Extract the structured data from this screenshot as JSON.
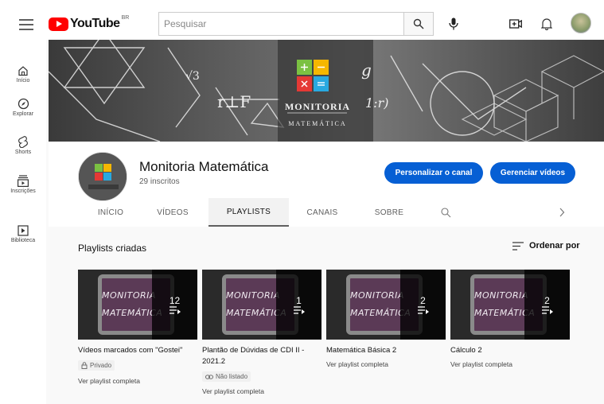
{
  "header": {
    "logo_text": "YouTube",
    "country_code": "BR",
    "search_placeholder": "Pesquisar"
  },
  "sidebar": {
    "items": [
      {
        "label": "Início",
        "icon": "home-icon"
      },
      {
        "label": "Explorar",
        "icon": "compass-icon"
      },
      {
        "label": "Shorts",
        "icon": "shorts-icon"
      },
      {
        "label": "Inscrições",
        "icon": "subscriptions-icon"
      },
      {
        "label": "Biblioteca",
        "icon": "library-icon"
      }
    ]
  },
  "banner": {
    "brand_text": "MONITORIA",
    "brand_subtext": "MATEMÁTICA",
    "math_text_1": "√3",
    "math_text_2": "r⊥F",
    "math_text_3": "g",
    "math_text_4": "1:r)"
  },
  "channel": {
    "name": "Monitoria Matemática",
    "subscribers": "29 inscritos",
    "customize_label": "Personalizar o canal",
    "manage_label": "Gerenciar vídeos",
    "tabs": [
      "INÍCIO",
      "VÍDEOS",
      "PLAYLISTS",
      "CANAIS",
      "SOBRE"
    ],
    "active_tab": "PLAYLISTS"
  },
  "content": {
    "section_title": "Playlists criadas",
    "sort_label": "Ordenar por",
    "thumb_line_1": "MONITORIA",
    "thumb_line_2": "MATEMÁTICA",
    "playlists": [
      {
        "title": "Vídeos marcados com \"Gostei\"",
        "count": "12",
        "badge": "Privado",
        "link": "Ver playlist completa"
      },
      {
        "title": "Plantão de Dúvidas de CDI II - 2021.2",
        "count": "1",
        "badge": "Não listado",
        "link": "Ver playlist completa"
      },
      {
        "title": "Matemática Básica 2",
        "count": "2",
        "badge": "",
        "link": "Ver playlist completa"
      },
      {
        "title": "Cálculo 2",
        "count": "2",
        "badge": "",
        "link": "Ver playlist completa"
      }
    ]
  },
  "colors": {
    "accent_blue": "#065fd4",
    "youtube_red": "#ff0000",
    "thumb_purple": "#5b3a56"
  }
}
